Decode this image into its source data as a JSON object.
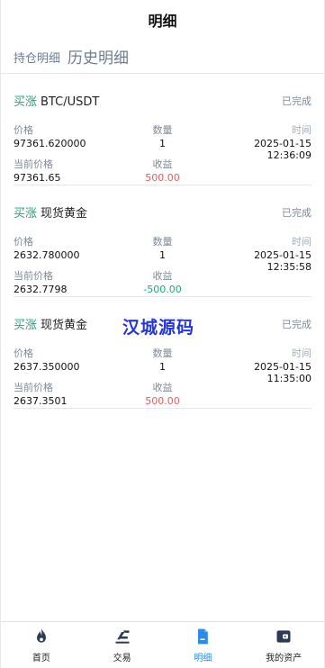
{
  "header": {
    "title": "明细"
  },
  "tabs": {
    "holdings": "持仓明细",
    "history": "历史明细"
  },
  "labels": {
    "price": "价格",
    "qty": "数量",
    "time": "时间",
    "current_price": "当前价格",
    "profit": "收益"
  },
  "records": [
    {
      "direction": "买涨",
      "symbol": "BTC/USDT",
      "status": "已完成",
      "price": "97361.620000",
      "qty": "1",
      "time": "2025-01-15 12:36:09",
      "current_price": "97361.65",
      "profit": "500.00",
      "profit_color": "#e65a5a"
    },
    {
      "direction": "买涨",
      "symbol": "现货黄金",
      "status": "已完成",
      "price": "2632.780000",
      "qty": "1",
      "time": "2025-01-15 12:35:58",
      "current_price": "2632.7798",
      "profit": "-500.00",
      "profit_color": "#1aa67c"
    },
    {
      "direction": "买涨",
      "symbol": "现货黄金",
      "status": "已完成",
      "price": "2637.350000",
      "qty": "1",
      "time": "2025-01-15 11:35:00",
      "current_price": "2637.3501",
      "profit": "500.00",
      "profit_color": "#e65a5a"
    }
  ],
  "watermark": "汉城源码",
  "nav": [
    {
      "label": "首页",
      "icon": "flame-icon"
    },
    {
      "label": "交易",
      "icon": "trade-icon"
    },
    {
      "label": "明细",
      "icon": "document-icon",
      "active": true
    },
    {
      "label": "我的资产",
      "icon": "wallet-icon"
    }
  ],
  "colors": {
    "accent": "#2a8ce6",
    "up": "#1aa67c",
    "loss": "#e65a5a"
  }
}
